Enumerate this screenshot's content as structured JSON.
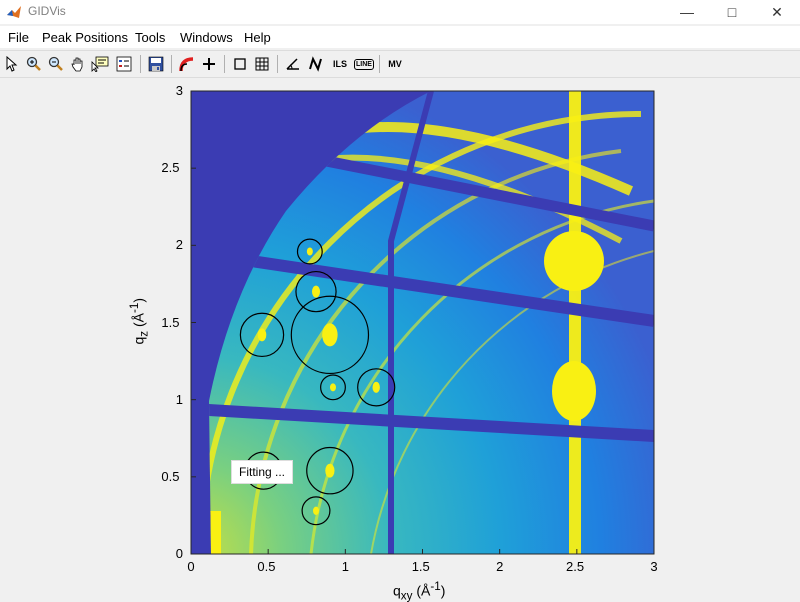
{
  "window": {
    "title": "GIDVis",
    "minimize_icon": "minimize-icon",
    "maximize_icon": "maximize-icon",
    "close_icon": "close-icon"
  },
  "menu": [
    "File",
    "Peak Positions",
    "Tools",
    "Windows",
    "Help"
  ],
  "toolbar": {
    "buttons": [
      "pointer-icon",
      "zoom-in-icon",
      "zoom-out-icon",
      "pan-icon",
      "data-cursor-icon",
      "legend-icon",
      "save-icon",
      "ring-icon",
      "crosshair-icon",
      "box-icon",
      "grid-icon",
      "angle-icon",
      "n-icon",
      "ILS",
      "LINE",
      "MV"
    ]
  },
  "plot": {
    "x_ticks": [
      "0",
      "0.5",
      "1",
      "1.5",
      "2",
      "2.5",
      "3"
    ],
    "y_ticks": [
      "0",
      "0.5",
      "1",
      "1.5",
      "2",
      "2.5",
      "3"
    ],
    "xlabel": "q",
    "xlabel_sub": "xy",
    "xlabel_unit": " (Å",
    "xlabel_sup": "-1",
    "xlabel_end": ")",
    "ylabel": "q",
    "ylabel_sub": "z",
    "ylabel_unit": " (Å",
    "ylabel_sup": "-1",
    "ylabel_end": ")",
    "status_text": "Fitting ...",
    "colors": {
      "background": "#3b3cb3",
      "mid": "#1fa0d8",
      "high": "#4ec0a0",
      "peak": "#f9f013"
    }
  },
  "chart_data": {
    "type": "heatmap",
    "xlim": [
      0,
      3
    ],
    "ylim": [
      0,
      3
    ],
    "circles": [
      {
        "q_xy": 0.77,
        "q_z": 1.96,
        "r": 0.08
      },
      {
        "q_xy": 0.81,
        "q_z": 1.7,
        "r": 0.13
      },
      {
        "q_xy": 0.46,
        "q_z": 1.42,
        "r": 0.14
      },
      {
        "q_xy": 0.9,
        "q_z": 1.42,
        "r": 0.25
      },
      {
        "q_xy": 0.92,
        "q_z": 1.08,
        "r": 0.08
      },
      {
        "q_xy": 1.2,
        "q_z": 1.08,
        "r": 0.12
      },
      {
        "q_xy": 0.47,
        "q_z": 0.54,
        "r": 0.12
      },
      {
        "q_xy": 0.9,
        "q_z": 0.54,
        "r": 0.15
      },
      {
        "q_xy": 0.81,
        "q_z": 0.28,
        "r": 0.09
      }
    ]
  }
}
